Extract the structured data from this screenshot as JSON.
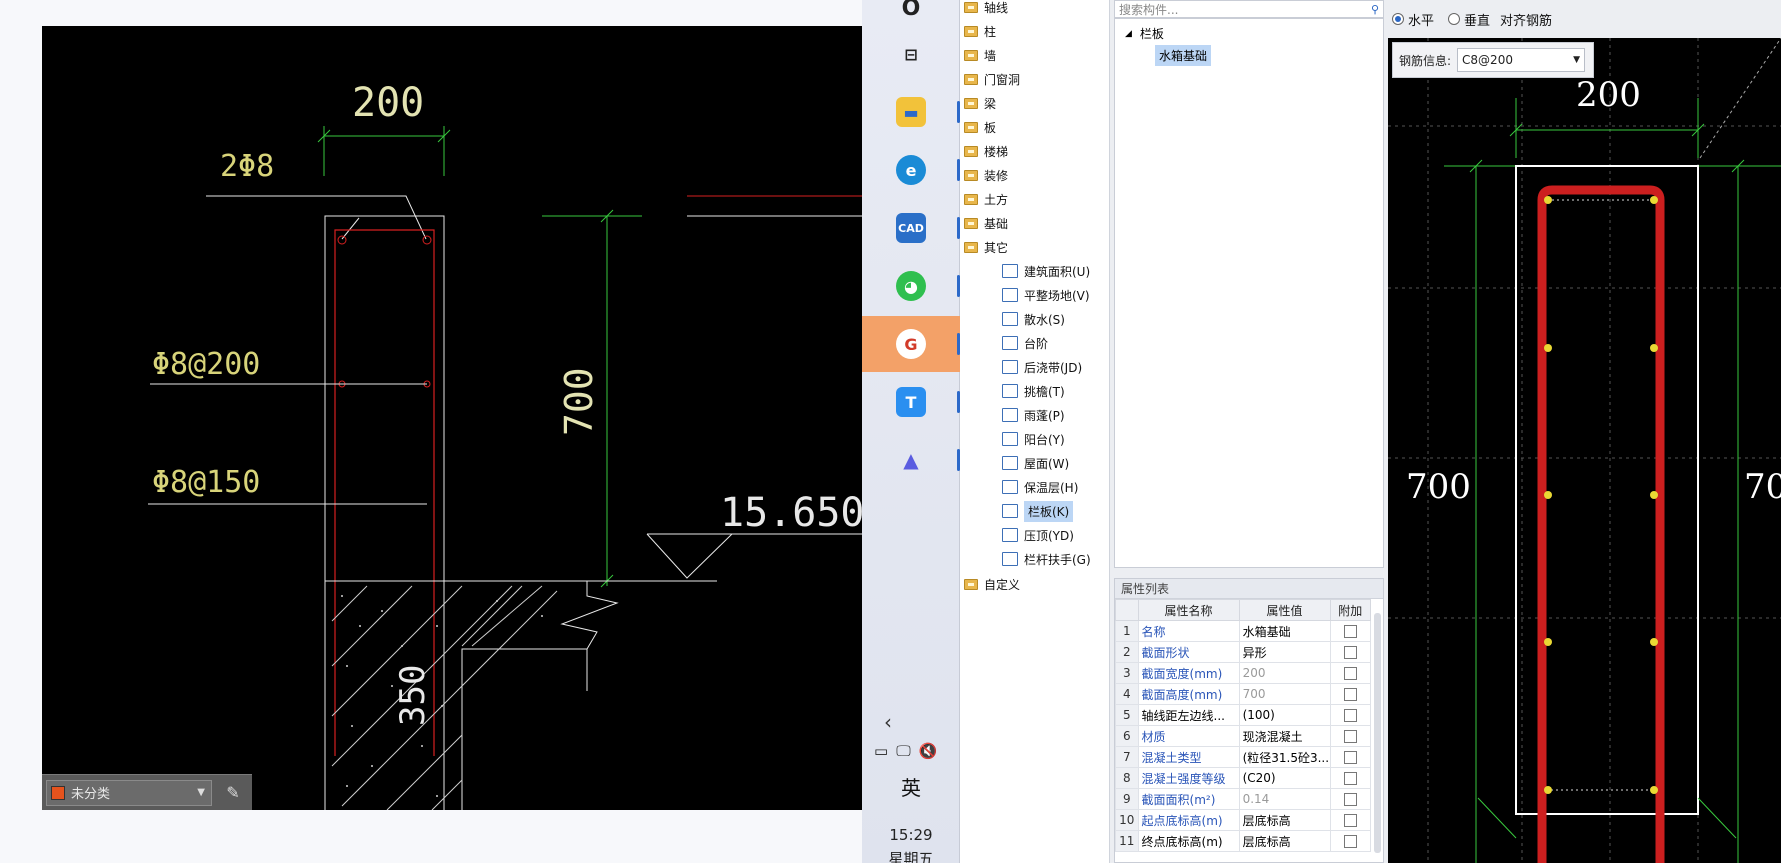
{
  "cad": {
    "dim_top": "200",
    "bar_label": "2Φ8",
    "bar_label_mid": "Φ8@200",
    "bar_label_low": "Φ8@150",
    "dim_height": "700",
    "elevation": "15.650",
    "dim_base": "350",
    "layer_name": "未分类"
  },
  "taskbar": {
    "lang": "英",
    "time": "15:29",
    "day": "星期五"
  },
  "tree": {
    "folders": [
      "轴线",
      "柱",
      "墙",
      "门窗洞",
      "梁",
      "板",
      "楼梯",
      "装修",
      "土方",
      "基础",
      "其它"
    ],
    "items": [
      "建筑面积(U)",
      "平整场地(V)",
      "散水(S)",
      "台阶",
      "后浇带(JD)",
      "挑檐(T)",
      "雨蓬(P)",
      "阳台(Y)",
      "屋面(W)",
      "保温层(H)",
      "栏板(K)",
      "压顶(YD)",
      "栏杆扶手(G)"
    ],
    "custom": "自定义",
    "selected": "栏板(K)"
  },
  "middle": {
    "search_placeholder": "搜索构件...",
    "group": "栏板",
    "selected_item": "水箱基础",
    "prop_title": "属性列表",
    "headers": [
      "属性名称",
      "属性值",
      "附加"
    ],
    "rows": [
      {
        "n": "1",
        "name": "名称",
        "value": "水箱基础"
      },
      {
        "n": "2",
        "name": "截面形状",
        "value": "异形"
      },
      {
        "n": "3",
        "name": "截面宽度(mm)",
        "value": "200"
      },
      {
        "n": "4",
        "name": "截面高度(mm)",
        "value": "700"
      },
      {
        "n": "5",
        "name": "轴线距左边线...",
        "value": "(100)"
      },
      {
        "n": "6",
        "name": "材质",
        "value": "现浇混凝土"
      },
      {
        "n": "7",
        "name": "混凝土类型",
        "value": "(粒径31.5砼3..."
      },
      {
        "n": "8",
        "name": "混凝土强度等级",
        "value": "(C20)"
      },
      {
        "n": "9",
        "name": "截面面积(m²)",
        "value": "0.14"
      },
      {
        "n": "10",
        "name": "起点底标高(m)",
        "value": "层底标高"
      },
      {
        "n": "11",
        "name": "终点底标高(m)",
        "value": "层底标高"
      }
    ]
  },
  "rebar": {
    "radio_h": "水平",
    "radio_v": "垂直",
    "align": "对齐钢筋",
    "info_label": "钢筋信息:",
    "info_value": "C8@200",
    "dim_top": "200",
    "dim_left": "700",
    "dim_right": "70"
  }
}
